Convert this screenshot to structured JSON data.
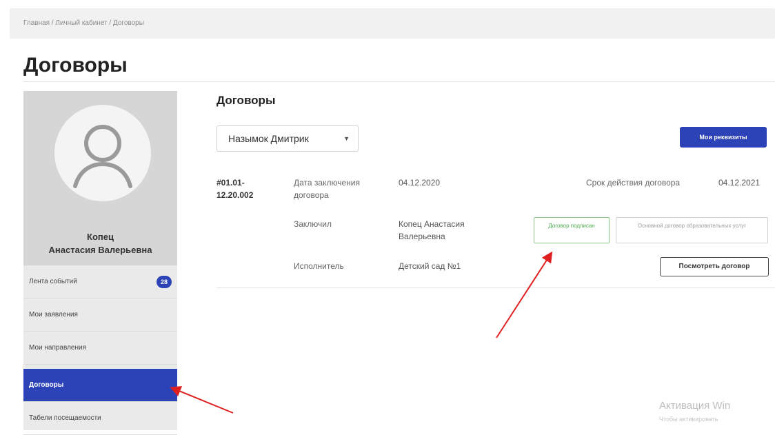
{
  "breadcrumb": "Главная / Личный кабинет / Договоры",
  "page": {
    "title": "Договоры"
  },
  "sidebar": {
    "user_name_line1": "Копец",
    "user_name_line2": "Анастасия Валерьевна",
    "items": [
      {
        "label": "Лента событий",
        "badge": "28"
      },
      {
        "label": "Мои заявления"
      },
      {
        "label": "Мои направления"
      },
      {
        "label": "Договоры",
        "active": true
      },
      {
        "label": "Табели посещаемости"
      }
    ]
  },
  "contracts": {
    "section_title": "Договоры",
    "child_select_value": "Назымок Дмитрик",
    "requisites_button": "Мои реквизиты",
    "contract": {
      "number": "#01.01-12.20.002",
      "date_label": "Дата заключения договора",
      "date_value": "04.12.2020",
      "validity_label": "Срок действия договора",
      "validity_value": "04.12.2021",
      "concluded_label": "Заключил",
      "concluded_value": "Копец Анастасия Валерьевна",
      "executor_label": "Исполнитель",
      "executor_value": "Детский сад №1",
      "status_signed": "Договор подписан",
      "status_type": "Основной договор образовательных услуг",
      "view_button": "Посмотреть договор"
    }
  },
  "watermark": {
    "line1": "Активация Win",
    "line2": "Чтобы активировать"
  },
  "colors": {
    "primary": "#2c43b8",
    "signed_green": "#4fae4f",
    "annotation_arrow": "#e02020"
  }
}
